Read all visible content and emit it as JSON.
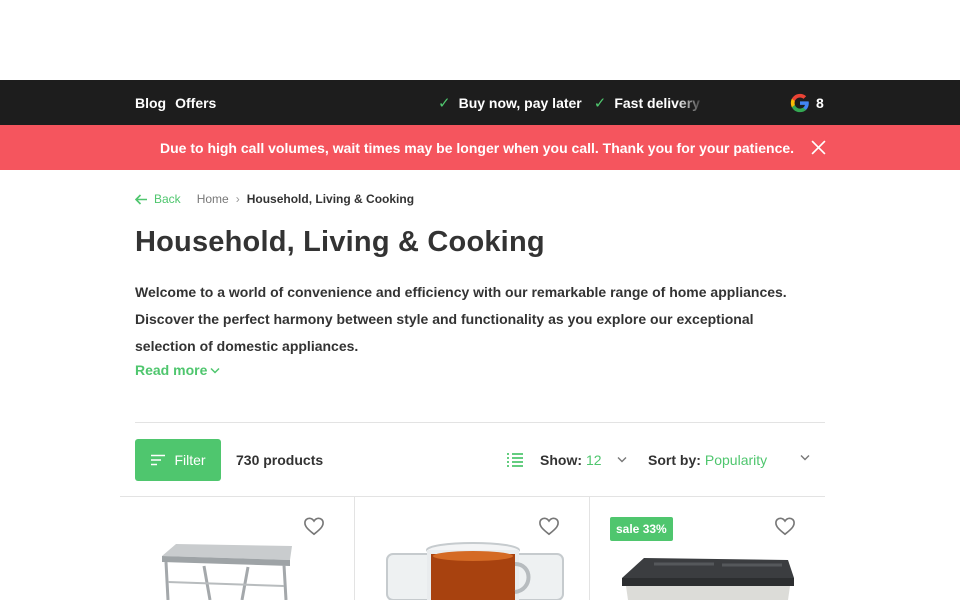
{
  "topbar": {
    "links": [
      "Blog",
      "Offers"
    ],
    "usps": [
      "Buy now, pay later",
      "Fast delivery"
    ],
    "review_score": "8"
  },
  "notice": {
    "message": "Due to high call volumes, wait times may be longer when you call. Thank you for your patience."
  },
  "breadcrumb": {
    "back": "Back",
    "home": "Home",
    "current": "Household, Living & Cooking"
  },
  "category": {
    "title": "Household, Living & Cooking",
    "description": "Welcome to a world of convenience and efficiency with our remarkable range of home appliances. Discover the perfect harmony between style and functionality as you explore our exceptional selection of domestic appliances.",
    "read_more": "Read more"
  },
  "toolbar": {
    "filter_label": "Filter",
    "product_count": "730 products",
    "show_label": "Show:",
    "show_value": "12",
    "sort_label": "Sort by:",
    "sort_value": "Popularity"
  },
  "products": [
    {
      "name_icon": "folding-table",
      "badge": ""
    },
    {
      "name_icon": "glass-tea-mugs",
      "badge": ""
    },
    {
      "name_icon": "storage-box",
      "badge": "sale 33%"
    }
  ],
  "colors": {
    "accent": "#4fc66e",
    "topbar": "#1d1d1d",
    "notice": "#f5555e"
  }
}
